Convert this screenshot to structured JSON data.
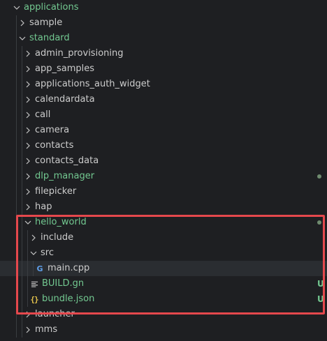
{
  "explorer": {
    "items": [
      {
        "label": "applications",
        "name": "folder-applications",
        "depth": 0,
        "kind": "folder",
        "expanded": true,
        "color": "green"
      },
      {
        "label": "sample",
        "name": "folder-sample",
        "depth": 1,
        "kind": "folder",
        "expanded": false,
        "color": "default"
      },
      {
        "label": "standard",
        "name": "folder-standard",
        "depth": 1,
        "kind": "folder",
        "expanded": true,
        "color": "green"
      },
      {
        "label": "admin_provisioning",
        "name": "folder-admin-provisioning",
        "depth": 2,
        "kind": "folder",
        "expanded": false,
        "color": "default"
      },
      {
        "label": "app_samples",
        "name": "folder-app-samples",
        "depth": 2,
        "kind": "folder",
        "expanded": false,
        "color": "default"
      },
      {
        "label": "applications_auth_widget",
        "name": "folder-applications-auth-widget",
        "depth": 2,
        "kind": "folder",
        "expanded": false,
        "color": "default"
      },
      {
        "label": "calendardata",
        "name": "folder-calendardata",
        "depth": 2,
        "kind": "folder",
        "expanded": false,
        "color": "default"
      },
      {
        "label": "call",
        "name": "folder-call",
        "depth": 2,
        "kind": "folder",
        "expanded": false,
        "color": "default"
      },
      {
        "label": "camera",
        "name": "folder-camera",
        "depth": 2,
        "kind": "folder",
        "expanded": false,
        "color": "default"
      },
      {
        "label": "contacts",
        "name": "folder-contacts",
        "depth": 2,
        "kind": "folder",
        "expanded": false,
        "color": "default"
      },
      {
        "label": "contacts_data",
        "name": "folder-contacts-data",
        "depth": 2,
        "kind": "folder",
        "expanded": false,
        "color": "default"
      },
      {
        "label": "dlp_manager",
        "name": "folder-dlp-manager",
        "depth": 2,
        "kind": "folder",
        "expanded": false,
        "color": "green",
        "dot": true
      },
      {
        "label": "filepicker",
        "name": "folder-filepicker",
        "depth": 2,
        "kind": "folder",
        "expanded": false,
        "color": "default"
      },
      {
        "label": "hap",
        "name": "folder-hap",
        "depth": 2,
        "kind": "folder",
        "expanded": false,
        "color": "default"
      },
      {
        "label": "hello_world",
        "name": "folder-hello-world",
        "depth": 2,
        "kind": "folder",
        "expanded": true,
        "color": "green",
        "dot": true
      },
      {
        "label": "include",
        "name": "folder-include",
        "depth": 3,
        "kind": "folder",
        "expanded": false,
        "color": "default"
      },
      {
        "label": "src",
        "name": "folder-src",
        "depth": 3,
        "kind": "folder",
        "expanded": true,
        "color": "default"
      },
      {
        "label": "main.cpp",
        "name": "file-main-cpp",
        "depth": 4,
        "kind": "cpp",
        "color": "default",
        "selected": true
      },
      {
        "label": "BUILD.gn",
        "name": "file-build-gn",
        "depth": 3,
        "kind": "gn",
        "color": "green",
        "badge": "U"
      },
      {
        "label": "bundle.json",
        "name": "file-bundle-json",
        "depth": 3,
        "kind": "json",
        "color": "green",
        "badge": "U"
      },
      {
        "label": "launcher",
        "name": "folder-launcher",
        "depth": 2,
        "kind": "folder",
        "expanded": false,
        "color": "default"
      },
      {
        "label": "mms",
        "name": "folder-mms",
        "depth": 2,
        "kind": "folder",
        "expanded": false,
        "color": "default"
      }
    ]
  },
  "icons": {
    "cpp_glyph": "G",
    "json_glyph": "{}"
  },
  "colors": {
    "modified_green": "#73c991",
    "highlight_red": "#e5484d",
    "cpp_blue": "#5f9ee8",
    "json_yellow": "#e2c14c"
  }
}
